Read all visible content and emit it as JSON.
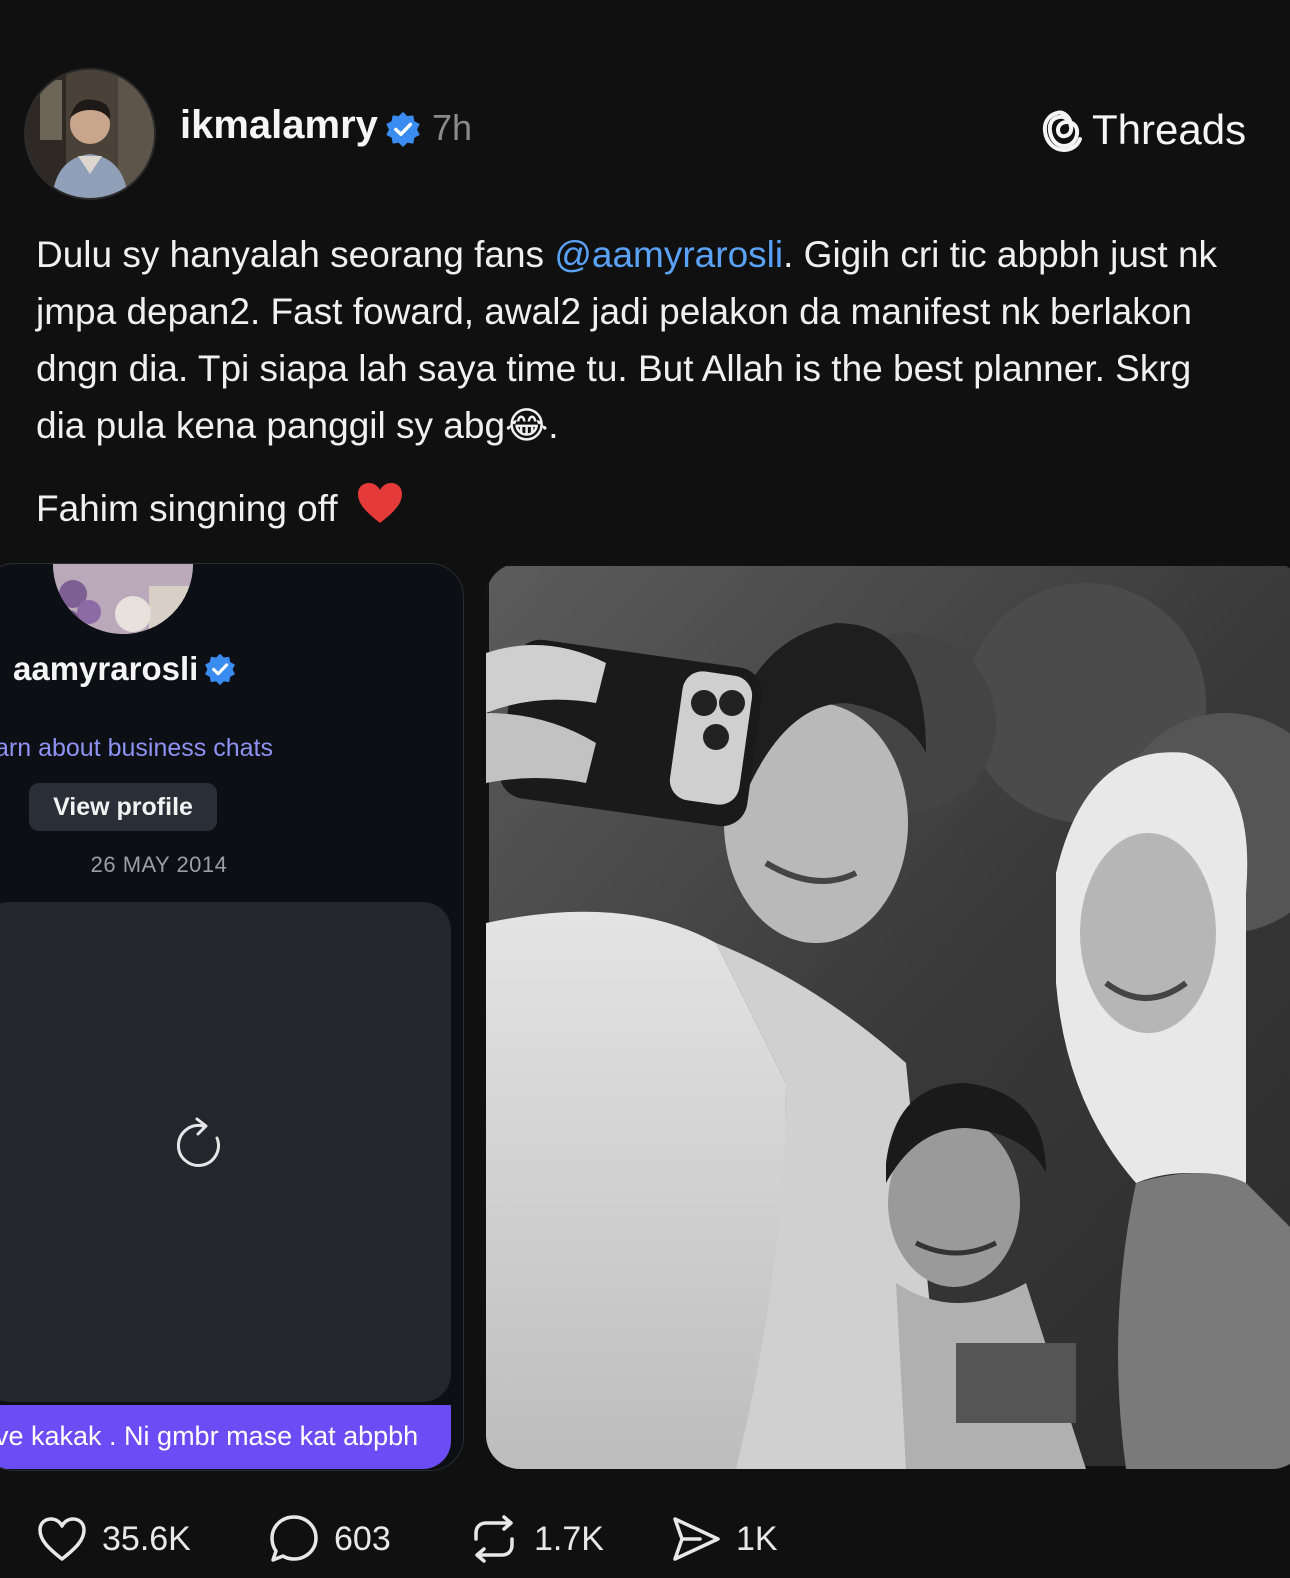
{
  "post": {
    "username": "ikmalamry",
    "time": "7h",
    "app_name": "Threads",
    "text_before_mention": "Dulu sy hanyalah seorang fans ",
    "mention": "@aamyrarosli",
    "text_after_mention": ". Gigih cri tic abpbh just nk jmpa depan2. Fast foward, awal2 jadi pelakon da manifest nk berlakon dngn dia. Tpi siapa lah saya time tu. But Allah is the best planner. Skrg dia pula kena panggil sy abg",
    "laugh_emoji": "😂",
    "text_end": ".",
    "signoff": "Fahim singning off",
    "signoff_emoji": "❤️"
  },
  "embedded_card": {
    "profile_name": "aamyrarosli",
    "learn_link": "arn about business chats",
    "view_profile_label": "View profile",
    "date": "26 MAY 2014",
    "message": "ve kakak . Ni gmbr mase kat abpbh"
  },
  "actions": {
    "likes": "35.6K",
    "comments": "603",
    "reposts": "1.7K",
    "shares": "1K"
  },
  "icons": {
    "verified": "verified-badge-icon",
    "threads": "threads-logo-icon",
    "like": "heart-icon",
    "comment": "comment-icon",
    "repost": "repost-icon",
    "share": "send-icon",
    "reload": "reload-icon"
  },
  "colors": {
    "background": "#101010",
    "mention": "#5aa2f5",
    "verified": "#3b8cf0",
    "link": "#8e92f2",
    "message_bubble": "#6c4df5"
  }
}
